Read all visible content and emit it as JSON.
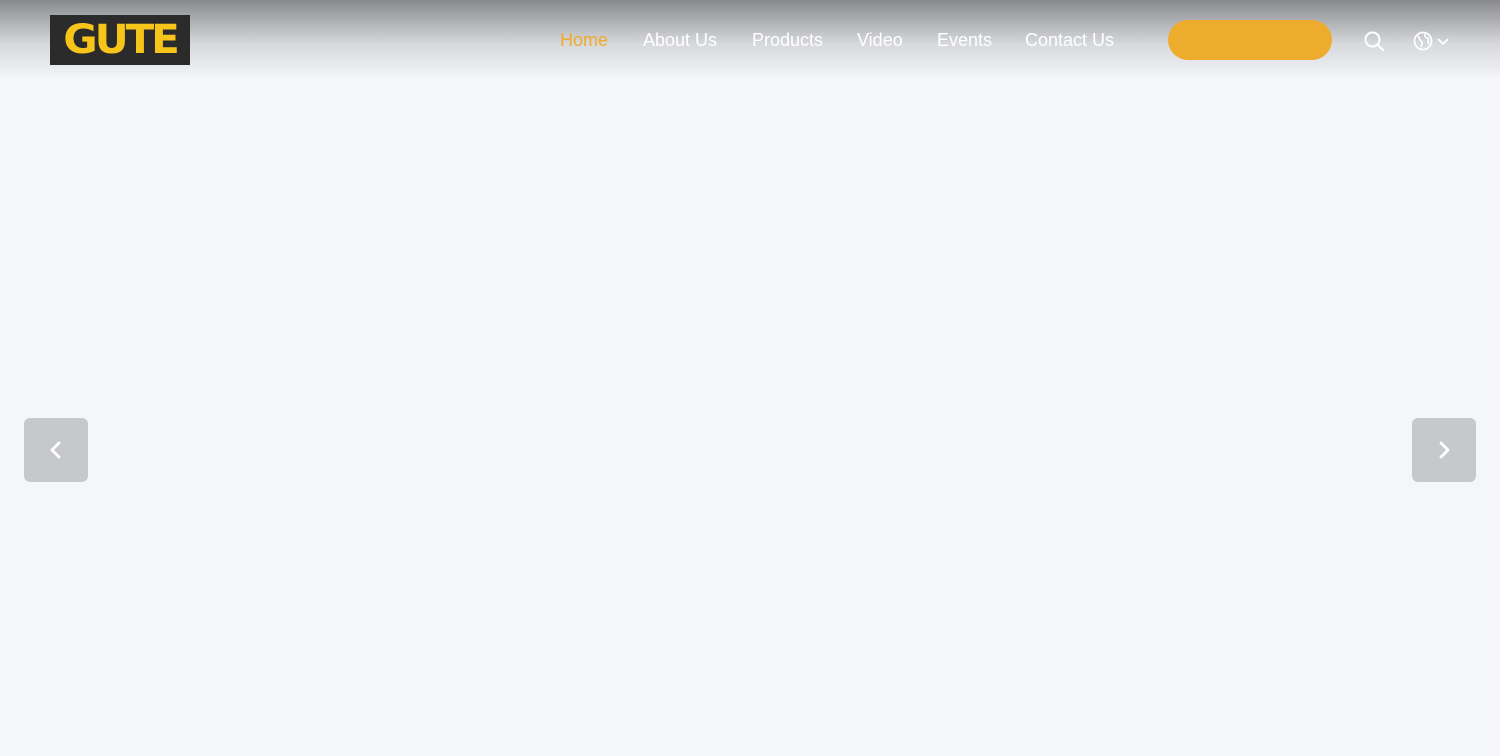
{
  "brand": {
    "logo_text": "GUTE",
    "logo_color": "#f7c51a",
    "logo_bg": "#2b2b2b"
  },
  "nav": {
    "items": [
      {
        "label": "Home",
        "active": true
      },
      {
        "label": "About Us",
        "active": false
      },
      {
        "label": "Products",
        "active": false
      },
      {
        "label": "Video",
        "active": false
      },
      {
        "label": "Events",
        "active": false
      },
      {
        "label": "Contact Us",
        "active": false
      }
    ],
    "active_color": "#eeac29",
    "text_color": "#ffffff"
  },
  "cta": {
    "label": "",
    "color": "#eeac2f"
  },
  "icons": {
    "search": "search-icon",
    "language": "globe-icon",
    "language_caret": "chevron-down-icon"
  },
  "slider": {
    "prev": "chevron-left-icon",
    "next": "chevron-right-icon",
    "background": "#f4f6fa"
  }
}
